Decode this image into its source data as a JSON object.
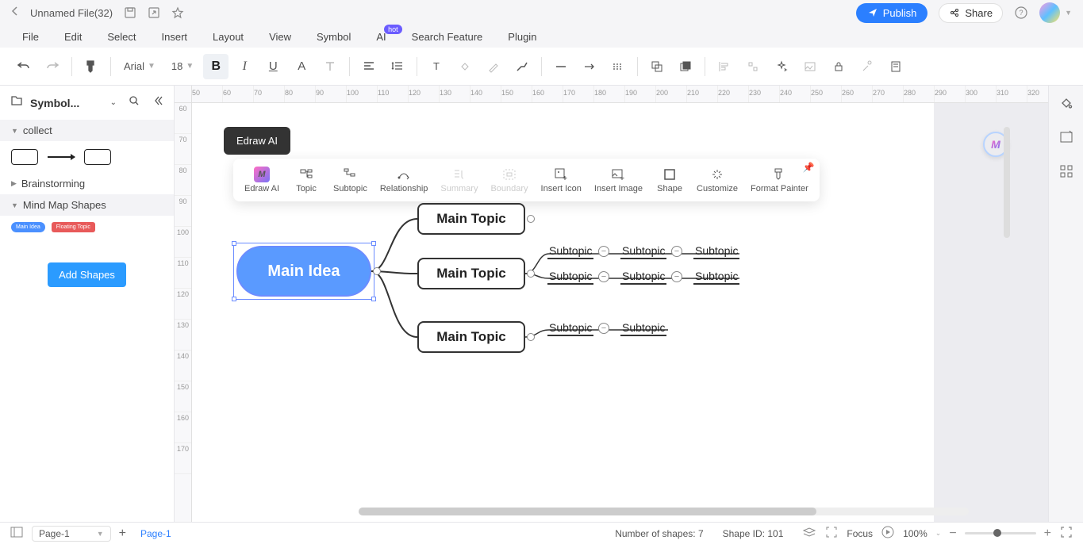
{
  "titlebar": {
    "filename": "Unnamed File(32)",
    "publish": "Publish",
    "share": "Share"
  },
  "menubar": {
    "items": [
      "File",
      "Edit",
      "Select",
      "Insert",
      "Layout",
      "View",
      "Symbol",
      "AI",
      "Search Feature",
      "Plugin"
    ],
    "ai_badge": "hot"
  },
  "toolbar": {
    "font": "Arial",
    "fontsize": "18"
  },
  "leftpanel": {
    "title": "Symbol...",
    "sections": {
      "collect": "collect",
      "brainstorm": "Brainstorming",
      "mmshapes": "Mind Map Shapes"
    },
    "mm_blue": "Main Idea",
    "mm_red": "Floating Topic",
    "add": "Add Shapes"
  },
  "ruler_h": [
    "50",
    "60",
    "70",
    "80",
    "90",
    "100",
    "110",
    "120",
    "130",
    "140",
    "150",
    "160",
    "170",
    "180",
    "190",
    "200",
    "210",
    "220",
    "230",
    "240",
    "250",
    "260",
    "270",
    "280",
    "290",
    "300",
    "310",
    "320"
  ],
  "ruler_v": [
    "60",
    "70",
    "80",
    "90",
    "100",
    "110",
    "120",
    "130",
    "140",
    "150",
    "160",
    "170"
  ],
  "tooltip": "Edraw AI",
  "float_toolbar": {
    "items": [
      {
        "label": "Edraw AI"
      },
      {
        "label": "Topic"
      },
      {
        "label": "Subtopic"
      },
      {
        "label": "Relationship"
      },
      {
        "label": "Summary",
        "disabled": true
      },
      {
        "label": "Boundary",
        "disabled": true
      },
      {
        "label": "Insert Icon"
      },
      {
        "label": "Insert Image"
      },
      {
        "label": "Shape"
      },
      {
        "label": "Customize"
      },
      {
        "label": "Format Painter"
      }
    ]
  },
  "mindmap": {
    "root": "Main Idea",
    "topics": [
      "Main Topic",
      "Main Topic",
      "Main Topic"
    ],
    "subtopic": "Subtopic"
  },
  "ai_badge_text": "M",
  "statusbar": {
    "page_select": "Page-1",
    "tab": "Page-1",
    "shapes_label": "Number of shapes:",
    "shapes_count": "7",
    "shapeid_label": "Shape ID:",
    "shapeid": "101",
    "focus": "Focus",
    "zoom": "100%"
  }
}
